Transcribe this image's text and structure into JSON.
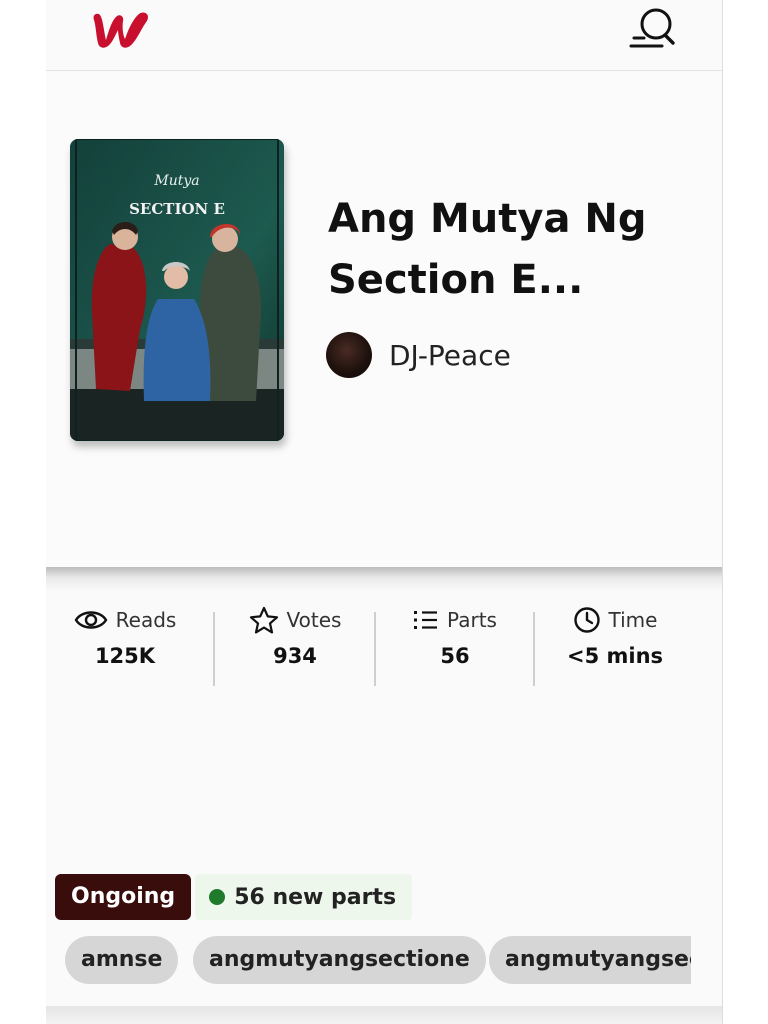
{
  "header": {
    "logo_icon": "wattpad-w-logo",
    "logo_color": "#c8102e",
    "search_icon": "search-icon"
  },
  "story": {
    "title": "Ang Mutya Ng Section E...",
    "cover_icon": "book-cover-image",
    "author": {
      "name": "DJ-Peace",
      "avatar_icon": "author-avatar"
    }
  },
  "stats": [
    {
      "icon": "eye-icon",
      "label": "Reads",
      "value": "125K"
    },
    {
      "icon": "star-icon",
      "label": "Votes",
      "value": "934"
    },
    {
      "icon": "list-icon",
      "label": "Parts",
      "value": "56"
    },
    {
      "icon": "clock-icon",
      "label": "Time",
      "value": "<5 mins"
    }
  ],
  "status": {
    "badge": "Ongoing",
    "badge_color": "#3a0d0d",
    "new_parts": "56 new parts",
    "dot_color": "#1f7a2c"
  },
  "tags": [
    "amnse",
    "angmutyangsectione",
    "angmutyangsec"
  ]
}
